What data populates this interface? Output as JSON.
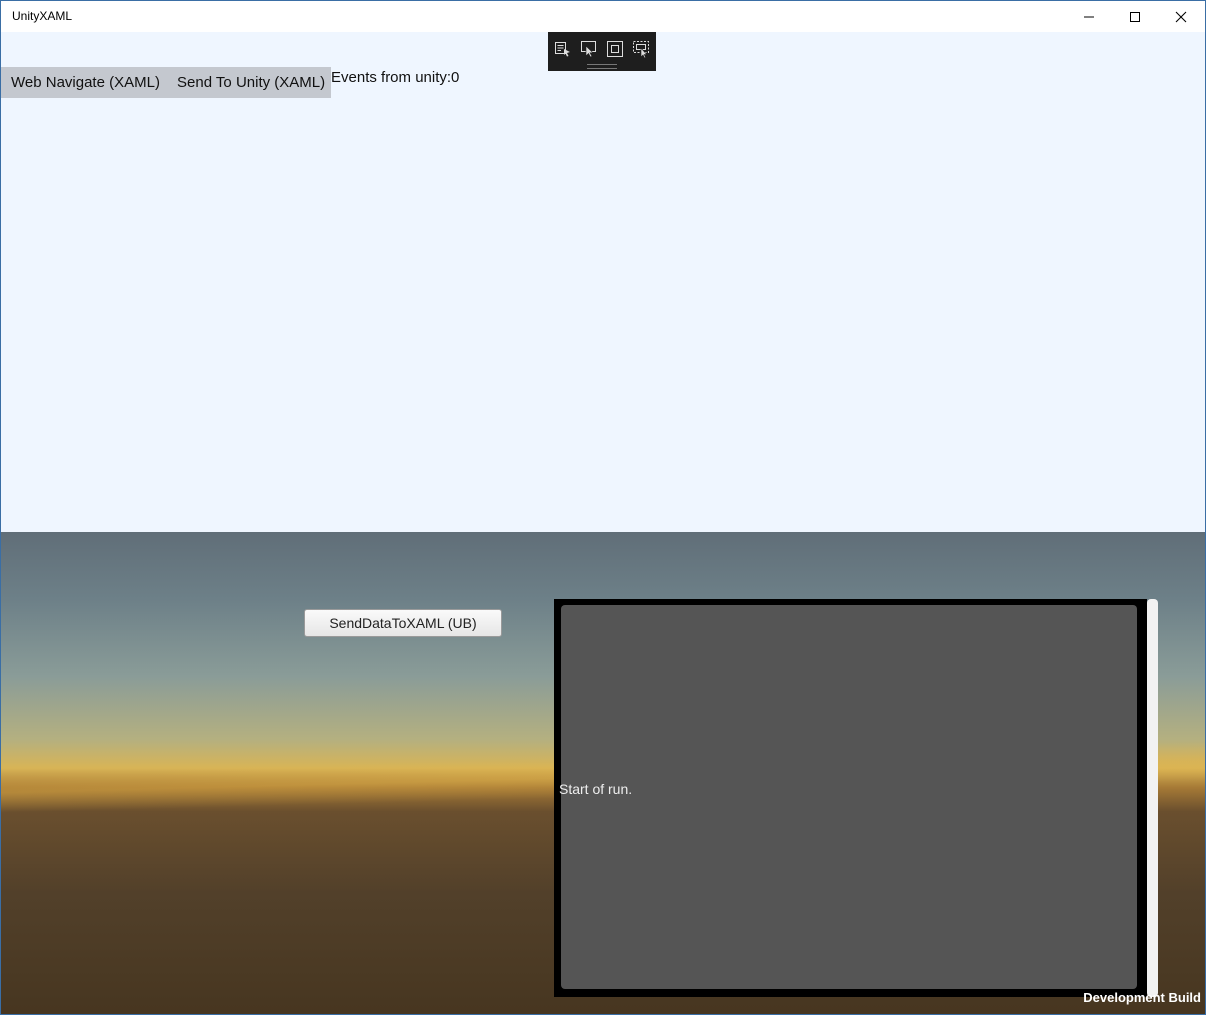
{
  "window": {
    "title": "UnityXAML",
    "minimize_icon": "minimize-icon",
    "maximize_icon": "maximize-icon",
    "close_icon": "close-icon"
  },
  "debug_toolbar": {
    "icons": [
      "select-element-icon",
      "live-visual-tree-pointer-icon",
      "display-layout-adorners-icon",
      "track-focus-icon"
    ]
  },
  "xaml": {
    "buttons": {
      "web_navigate": "Web Navigate (XAML)",
      "send_to_unity": "Send To Unity (XAML)"
    },
    "events_text": "Events from unity:0"
  },
  "unity": {
    "send_button": "SendDataToXAML (UB)",
    "log_text": "Start of run.",
    "dev_build": "Development Build"
  },
  "colors": {
    "xaml_background": "#eff6ff",
    "xaml_button": "#c4c8cf",
    "log_background": "#555555"
  }
}
